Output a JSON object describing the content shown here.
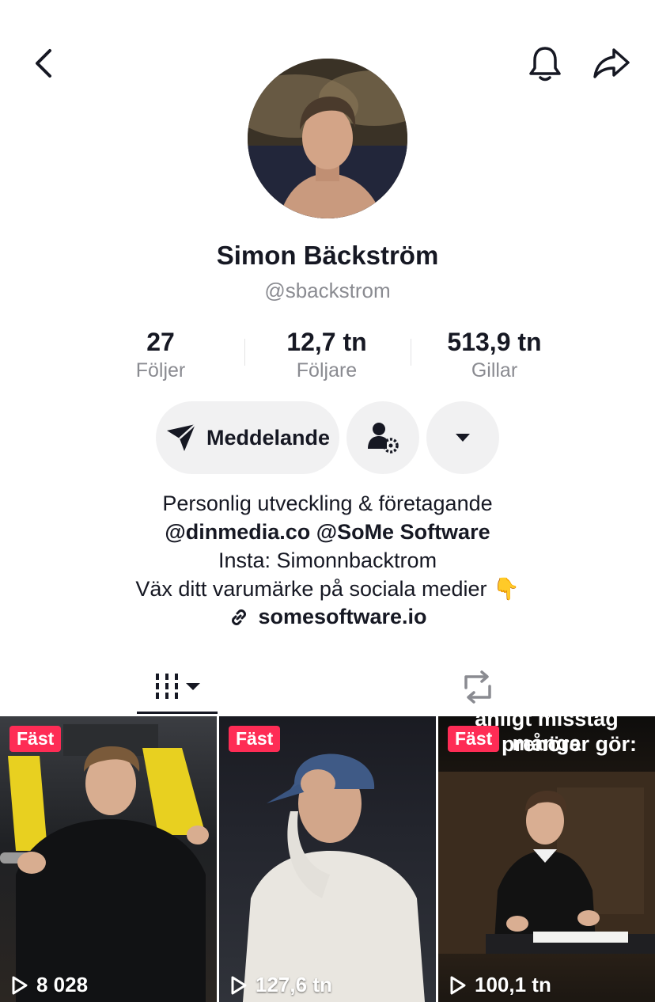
{
  "header": {
    "back_icon": "chevron-left-icon",
    "bell_icon": "bell-icon",
    "share_icon": "share-arrow-icon"
  },
  "profile": {
    "name": "Simon Bäckström",
    "handle": "@sbackstrom"
  },
  "stats": [
    {
      "value": "27",
      "label": "Följer"
    },
    {
      "value": "12,7 tn",
      "label": "Följare"
    },
    {
      "value": "513,9 tn",
      "label": "Gillar"
    }
  ],
  "actions": {
    "message_label": "Meddelande"
  },
  "bio": {
    "line1": "Personlig utveckling & företagande",
    "line2": "@dinmedia.co @SoMe Software",
    "line3": "Insta: Simonnbacktrom",
    "line4": "Väx ditt varumärke på sociala medier 👇",
    "link": "somesoftware.io"
  },
  "videos": [
    {
      "pinned_label": "Fäst",
      "views": "8 028",
      "caption": ""
    },
    {
      "pinned_label": "Fäst",
      "views": "127,6 tn",
      "caption": ""
    },
    {
      "pinned_label": "Fäst",
      "views": "100,1 tn",
      "caption_top": "anligt misstag många",
      "caption": "prenörer gör:"
    }
  ],
  "colors": {
    "accent": "#fe2c55",
    "muted": "#8a8b91",
    "pill_bg": "#f1f1f2"
  }
}
